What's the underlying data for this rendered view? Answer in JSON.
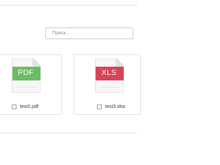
{
  "search": {
    "placeholder": "Поиск..."
  },
  "files": [
    {
      "name": "test2.pdf",
      "type_label": "PDF",
      "icon": "pdf-file-icon",
      "color": "#6dbb63"
    },
    {
      "name": "test3.xlsx",
      "type_label": "XLS",
      "icon": "xls-file-icon",
      "color": "#d6445a"
    }
  ]
}
